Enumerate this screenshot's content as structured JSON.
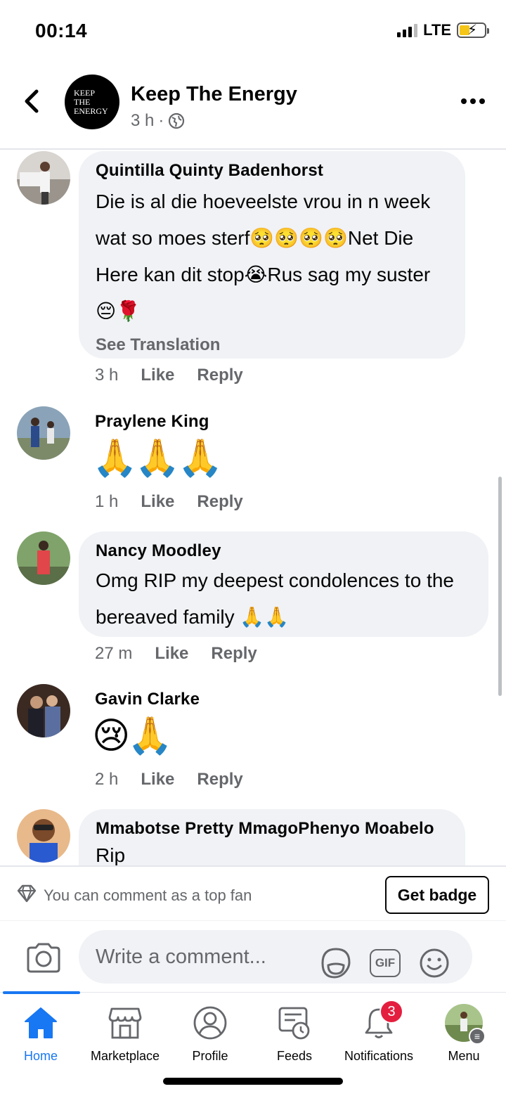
{
  "status_bar": {
    "time": "00:14",
    "network": "LTE"
  },
  "header": {
    "page_name": "Keep The Energy",
    "logo_lines": [
      "KEEP",
      "THE",
      "ENERGY"
    ],
    "time_ago": "3 h",
    "separator": "·",
    "privacy_icon": "globe-icon"
  },
  "comments": [
    {
      "author": "Quintilla Quinty Badenhorst",
      "lines": [
        "Die is al die hoeveelste vrou in n week",
        "wat so moes sterf🥺🥺🥺🥺Net Die",
        "Here kan dit stop😭Rus sag my suster",
        "😔🌹"
      ],
      "see_translation": "See Translation",
      "time": "3 h",
      "like": "Like",
      "reply": "Reply"
    },
    {
      "author": "Praylene King",
      "emoji": "🙏🙏🙏",
      "time": "1 h",
      "like": "Like",
      "reply": "Reply"
    },
    {
      "author": "Nancy Moodley",
      "lines": [
        "Omg RIP my deepest condolences to the",
        "bereaved family 🙏🙏"
      ],
      "time": "27 m",
      "like": "Like",
      "reply": "Reply"
    },
    {
      "author": "Gavin Clarke",
      "emoji": "😢🙏",
      "time": "2 h",
      "like": "Like",
      "reply": "Reply"
    },
    {
      "author": "Mmabotse Pretty MmagoPhenyo Moabelo",
      "text": "Rip"
    }
  ],
  "top_fan": {
    "text": "You can comment as a top fan",
    "button": "Get badge"
  },
  "composer": {
    "placeholder": "Write a comment...",
    "gif_label": "GIF"
  },
  "bottom_nav": {
    "items": [
      {
        "label": "Home",
        "icon": "home-icon",
        "active": true
      },
      {
        "label": "Marketplace",
        "icon": "marketplace-icon"
      },
      {
        "label": "Profile",
        "icon": "profile-icon"
      },
      {
        "label": "Feeds",
        "icon": "feeds-icon"
      },
      {
        "label": "Notifications",
        "icon": "bell-icon",
        "badge": "3"
      },
      {
        "label": "Menu",
        "icon": "menu-avatar"
      }
    ]
  },
  "colors": {
    "accent": "#1877f2",
    "badge": "#e41e3f",
    "bubble": "#f0f2f5",
    "secondary_text": "#65676b"
  }
}
